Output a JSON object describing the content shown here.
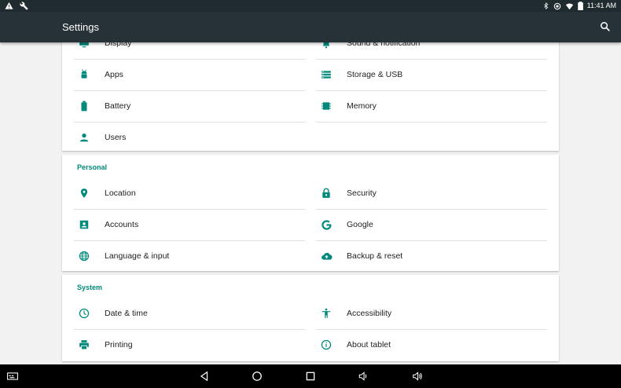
{
  "status_bar": {
    "time": "11:41 AM",
    "left_icons": [
      "warning-icon",
      "wrench-icon"
    ],
    "right_icons": [
      "bluetooth-icon",
      "sync-icon",
      "wifi-icon",
      "battery-icon"
    ]
  },
  "toolbar": {
    "title": "Settings",
    "search_icon": "search-icon"
  },
  "colors": {
    "accent": "#00897b",
    "toolbar": "#263238",
    "statusbar": "#202b30"
  },
  "device": {
    "items": [
      {
        "label": "Display",
        "icon": "display-icon"
      },
      {
        "label": "Sound & notification",
        "icon": "bell-icon"
      },
      {
        "label": "Apps",
        "icon": "android-icon"
      },
      {
        "label": "Storage & USB",
        "icon": "storage-icon"
      },
      {
        "label": "Battery",
        "icon": "battery-icon"
      },
      {
        "label": "Memory",
        "icon": "memory-icon"
      },
      {
        "label": "Users",
        "icon": "person-icon"
      }
    ]
  },
  "personal": {
    "header": "Personal",
    "items": [
      {
        "label": "Location",
        "icon": "location-pin-icon"
      },
      {
        "label": "Security",
        "icon": "lock-icon"
      },
      {
        "label": "Accounts",
        "icon": "account-box-icon"
      },
      {
        "label": "Google",
        "icon": "google-icon"
      },
      {
        "label": "Language & input",
        "icon": "globe-icon"
      },
      {
        "label": "Backup & reset",
        "icon": "cloud-upload-icon"
      }
    ]
  },
  "system": {
    "header": "System",
    "items": [
      {
        "label": "Date & time",
        "icon": "clock-icon"
      },
      {
        "label": "Accessibility",
        "icon": "accessibility-icon"
      },
      {
        "label": "Printing",
        "icon": "printer-icon"
      },
      {
        "label": "About tablet",
        "icon": "info-icon"
      }
    ]
  },
  "nav_bar": {
    "icons": [
      "keyboard-switcher-icon",
      "back-icon",
      "home-icon",
      "recents-icon",
      "volume-down-icon",
      "volume-up-icon"
    ]
  }
}
